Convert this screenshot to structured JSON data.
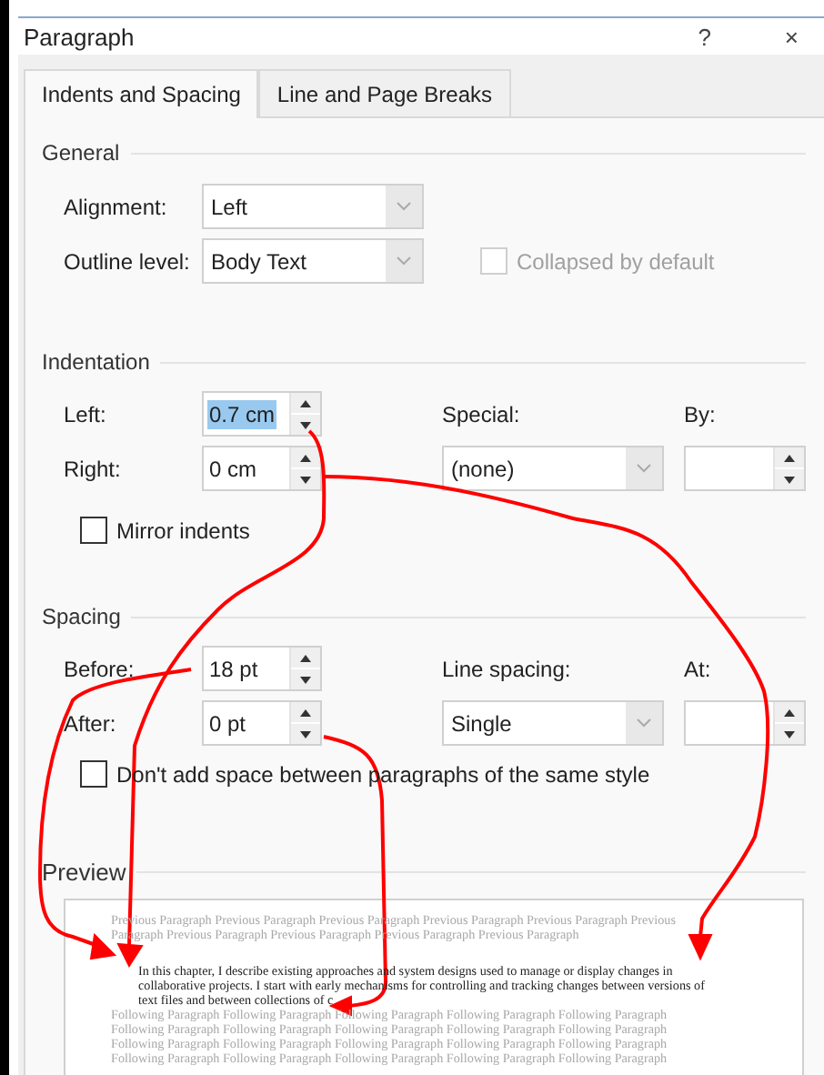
{
  "window": {
    "title": "Paragraph",
    "help": "?",
    "close": "×"
  },
  "tabs": [
    {
      "label": "Indents and Spacing",
      "selected": true
    },
    {
      "label": "Line and Page Breaks",
      "selected": false
    }
  ],
  "general": {
    "heading": "General",
    "alignment": {
      "label": "Alignment:",
      "value": "Left"
    },
    "outline_level": {
      "label": "Outline level:",
      "value": "Body Text"
    },
    "collapsed": {
      "label": "Collapsed by default",
      "checked": false,
      "disabled": true
    }
  },
  "indentation": {
    "heading": "Indentation",
    "left": {
      "label": "Left:",
      "value": "0.7 cm",
      "highlighted": true
    },
    "right": {
      "label": "Right:",
      "value": "0 cm",
      "highlighted": false
    },
    "special": {
      "label": "Special:",
      "value": "(none)"
    },
    "by": {
      "label": "By:"
    },
    "mirror": {
      "label": "Mirror indents",
      "checked": false,
      "disabled": false
    }
  },
  "spacing": {
    "heading": "Spacing",
    "before": {
      "label": "Before:",
      "value": "18 pt",
      "highlighted": false
    },
    "after": {
      "label": "After:",
      "value": "0 pt",
      "highlighted": false
    },
    "line_spacing": {
      "label": "Line spacing:",
      "value": "Single"
    },
    "at": {
      "label": "At:"
    },
    "dont_add": {
      "label": "Don't add space between paragraphs of the same style",
      "checked": false,
      "disabled": false
    }
  },
  "preview": {
    "heading": "Preview",
    "previous_lines": [
      "Previous Paragraph Previous Paragraph Previous Paragraph Previous Paragraph Previous Paragraph Previous",
      "Paragraph Previous Paragraph Previous Paragraph Previous Paragraph Previous Paragraph"
    ],
    "current_lines": [
      "In this chapter, I describe existing approaches and system designs used to manage or display changes in",
      "collaborative projects.  I start with early mechanisms for controlling and tracking changes between versions of",
      "text files and between collections of c"
    ],
    "following_lines": [
      "Following Paragraph Following Paragraph Following Paragraph Following Paragraph Following Paragraph",
      "Following Paragraph Following Paragraph Following Paragraph Following Paragraph Following Paragraph",
      "Following Paragraph Following Paragraph Following Paragraph Following Paragraph Following Paragraph",
      "Following Paragraph Following Paragraph Following Paragraph Following Paragraph Following Paragraph"
    ]
  }
}
